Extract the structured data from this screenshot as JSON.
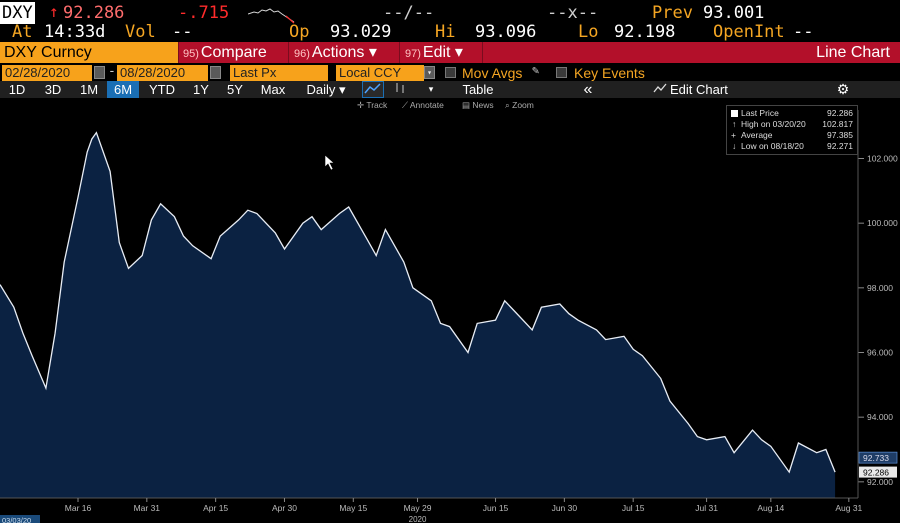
{
  "header": {
    "ticker": "DXY",
    "last_price": "92.286",
    "change": "-.715",
    "dashes": "--/--",
    "xx": "--x--",
    "prev_label": "Prev",
    "prev_value": "93.001",
    "at_label": "At",
    "time": "14:33d",
    "vol_label": "Vol",
    "vol_value": "--",
    "op_label": "Op",
    "op_value": "93.029",
    "hi_label": "Hi",
    "hi_value": "93.096",
    "lo_label": "Lo",
    "lo_value": "92.198",
    "openint_label": "OpenInt",
    "openint_value": "--"
  },
  "menu": {
    "security": "DXY Curncy",
    "compare_num": "95)",
    "compare": "Compare",
    "actions_num": "96)",
    "actions": "Actions ▾",
    "edit_num": "97)",
    "edit": "Edit ▾",
    "title": "Line Chart"
  },
  "controls": {
    "start_date": "02/28/2020",
    "end_date": "08/28/2020",
    "field": "Last Px",
    "currency": "Local CCY",
    "mov_avgs": "Mov Avgs",
    "key_events": "Key Events"
  },
  "periods": [
    "1D",
    "3D",
    "1M",
    "6M",
    "YTD",
    "1Y",
    "5Y",
    "Max"
  ],
  "active_period": "6M",
  "frequency": "Daily ▾",
  "table_label": "Table",
  "collapse_icon": "«",
  "edit_chart": "Edit Chart",
  "toolbar2": {
    "track": "Track",
    "annotate": "Annotate",
    "news": "News",
    "zoom": "Zoom"
  },
  "legend": {
    "rows": [
      {
        "key": "Last Price",
        "value": "92.286"
      },
      {
        "key": "High on 03/20/20",
        "value": "102.817"
      },
      {
        "key": "Average",
        "value": "97.385"
      },
      {
        "key": "Low on 08/18/20",
        "value": "92.271"
      }
    ]
  },
  "chart_data": {
    "type": "area",
    "series": [
      {
        "name": "Last Price",
        "x": [
          "2020-02-28",
          "2020-03-02",
          "2020-03-04",
          "2020-03-06",
          "2020-03-09",
          "2020-03-11",
          "2020-03-13",
          "2020-03-16",
          "2020-03-18",
          "2020-03-19",
          "2020-03-20",
          "2020-03-23",
          "2020-03-25",
          "2020-03-27",
          "2020-03-30",
          "2020-04-01",
          "2020-04-03",
          "2020-04-06",
          "2020-04-08",
          "2020-04-10",
          "2020-04-14",
          "2020-04-16",
          "2020-04-20",
          "2020-04-22",
          "2020-04-24",
          "2020-04-28",
          "2020-04-30",
          "2020-05-04",
          "2020-05-06",
          "2020-05-08",
          "2020-05-12",
          "2020-05-14",
          "2020-05-18",
          "2020-05-20",
          "2020-05-22",
          "2020-05-26",
          "2020-05-28",
          "2020-06-01",
          "2020-06-03",
          "2020-06-05",
          "2020-06-09",
          "2020-06-11",
          "2020-06-15",
          "2020-06-17",
          "2020-06-19",
          "2020-06-23",
          "2020-06-25",
          "2020-06-29",
          "2020-07-01",
          "2020-07-03",
          "2020-07-07",
          "2020-07-09",
          "2020-07-13",
          "2020-07-15",
          "2020-07-17",
          "2020-07-21",
          "2020-07-23",
          "2020-07-27",
          "2020-07-29",
          "2020-07-31",
          "2020-08-04",
          "2020-08-06",
          "2020-08-10",
          "2020-08-12",
          "2020-08-14",
          "2020-08-18",
          "2020-08-20",
          "2020-08-24",
          "2020-08-26",
          "2020-08-28"
        ],
        "values": [
          98.1,
          97.4,
          96.6,
          95.9,
          94.9,
          96.6,
          98.8,
          100.8,
          102.2,
          102.6,
          102.8,
          101.6,
          99.4,
          98.6,
          99.0,
          100.1,
          100.6,
          100.2,
          99.6,
          99.3,
          98.9,
          99.6,
          100.1,
          100.4,
          100.3,
          99.7,
          99.2,
          100.0,
          100.2,
          99.8,
          100.3,
          100.5,
          99.5,
          99.0,
          99.8,
          98.8,
          98.0,
          97.6,
          96.9,
          96.8,
          96.0,
          96.9,
          97.0,
          97.6,
          97.3,
          96.7,
          97.4,
          97.5,
          97.2,
          97.0,
          96.7,
          96.4,
          96.5,
          96.1,
          95.9,
          95.2,
          94.5,
          93.8,
          93.4,
          93.3,
          93.4,
          92.9,
          93.6,
          93.3,
          93.1,
          92.3,
          93.2,
          92.9,
          93.0,
          92.3
        ]
      }
    ],
    "x_ticks": [
      "Mar 16",
      "Mar 31",
      "Apr 15",
      "Apr 30",
      "May 15",
      "May 29",
      "Jun 15",
      "Jun 30",
      "Jul 15",
      "Jul 31",
      "Aug 14",
      "Aug 31"
    ],
    "x_year": "2020",
    "first_date": "03/03/20",
    "y_ticks": [
      "102.000",
      "100.000",
      "98.000",
      "96.000",
      "94.000",
      "92.000"
    ],
    "ylim": [
      91.5,
      103.5
    ],
    "last_label": "92.286",
    "ref_label": "92.733",
    "grid": false,
    "legend_position": "top-right",
    "line_color": "#e8edf5",
    "fill_color": "#0b2242"
  }
}
